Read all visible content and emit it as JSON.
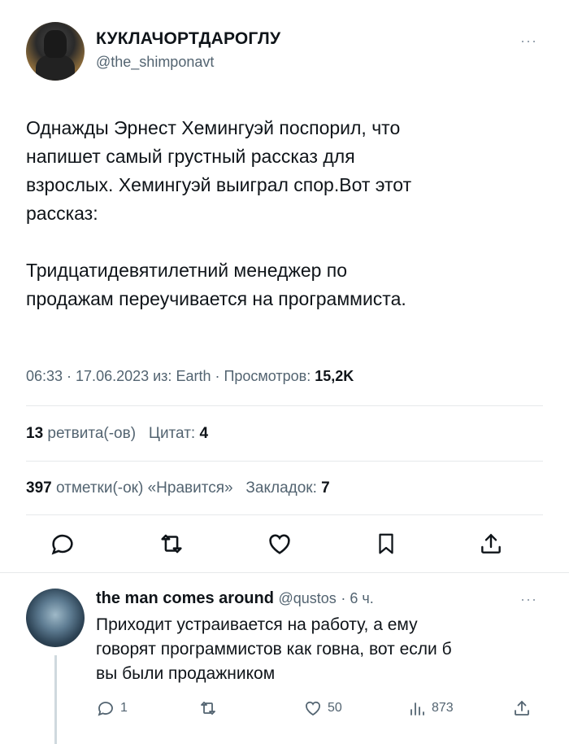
{
  "tweet": {
    "author_name": "КУКЛАЧОРТДАРОГЛУ",
    "author_handle": "@the_shimponavt",
    "more_label": "···",
    "paragraphs": [
      "Однажды Эрнест Хемингуэй поспорил, что\nнапишет самый грустный рассказ для\nвзрослых. Хемингуэй выиграл спор.Вот этот\nрассказ:",
      "Тридцатидевятилетний менеджер по\nпродажам переучивается на программиста."
    ],
    "meta_text": "06:33 · 17.06.2023 из: Earth · Просмотров: ",
    "views": "15,2K",
    "retweets_count": "13",
    "retweets_label": "ретвита(-ов)",
    "quotes_label": "Цитат:",
    "quotes_count": "4",
    "likes_count": "397",
    "likes_label": "отметки(-ок) «Нравится»",
    "bookmarks_label": "Закладок:",
    "bookmarks_count": "7",
    "actions": [
      "reply-icon",
      "retweet-icon",
      "like-icon",
      "bookmark-icon",
      "share-icon"
    ]
  },
  "reply": {
    "author_name": "the man comes around",
    "author_handle": "@qustos",
    "time": "· 6 ч.",
    "more_label": "···",
    "text": "Приходит устраивается на работу, а ему\nговорят программистов как говна, вот если б\nвы были продажником",
    "reply_count": "1",
    "retweet_count": "",
    "like_count": "50",
    "views_count": "873"
  },
  "colors": {
    "text": "#0f1419",
    "secondary": "#536471",
    "divider": "#e6e9eb"
  }
}
